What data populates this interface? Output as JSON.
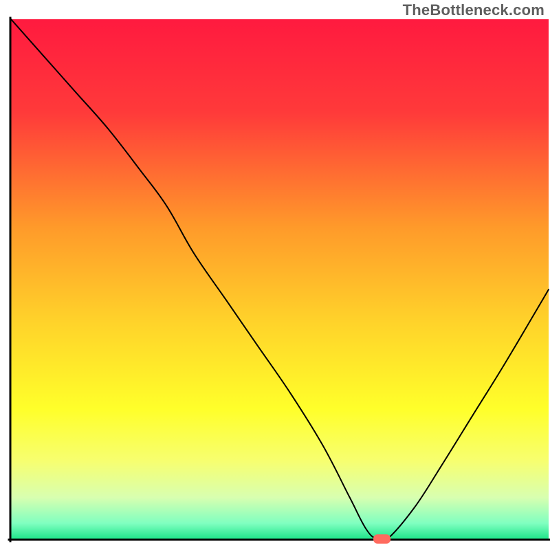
{
  "watermark": "TheBottleneck.com",
  "chart_data": {
    "type": "line",
    "title": "",
    "xlabel": "",
    "ylabel": "",
    "xlim": [
      0,
      100
    ],
    "ylim": [
      0,
      100
    ],
    "grid": false,
    "legend": false,
    "background": {
      "gradient_stops": [
        {
          "offset": 0.0,
          "color": "#ff1a3f"
        },
        {
          "offset": 0.18,
          "color": "#ff3a3a"
        },
        {
          "offset": 0.4,
          "color": "#ff9a2a"
        },
        {
          "offset": 0.58,
          "color": "#ffd22a"
        },
        {
          "offset": 0.75,
          "color": "#ffff2a"
        },
        {
          "offset": 0.85,
          "color": "#f7ff70"
        },
        {
          "offset": 0.92,
          "color": "#d8ffb0"
        },
        {
          "offset": 0.97,
          "color": "#7fffc0"
        },
        {
          "offset": 1.0,
          "color": "#1fe58a"
        }
      ]
    },
    "series": [
      {
        "name": "bottleneck-curve",
        "color": "#000000",
        "width": 2,
        "x": [
          0,
          6,
          12,
          18,
          24,
          29,
          34,
          40,
          46,
          52,
          58,
          63,
          66,
          68,
          70,
          75,
          80,
          86,
          92,
          100
        ],
        "values": [
          100,
          93,
          86,
          79,
          71,
          64,
          55,
          46,
          37,
          28,
          18,
          8,
          2,
          0,
          0,
          6,
          14,
          24,
          34,
          48
        ]
      }
    ],
    "markers": [
      {
        "name": "minimum-marker",
        "shape": "rounded-rect",
        "color": "#ff6b5f",
        "cx": 69,
        "cy": 0,
        "w": 3.2,
        "h": 1.8
      }
    ],
    "axes": {
      "color": "#000000",
      "width": 3,
      "show_ticks": false
    }
  }
}
